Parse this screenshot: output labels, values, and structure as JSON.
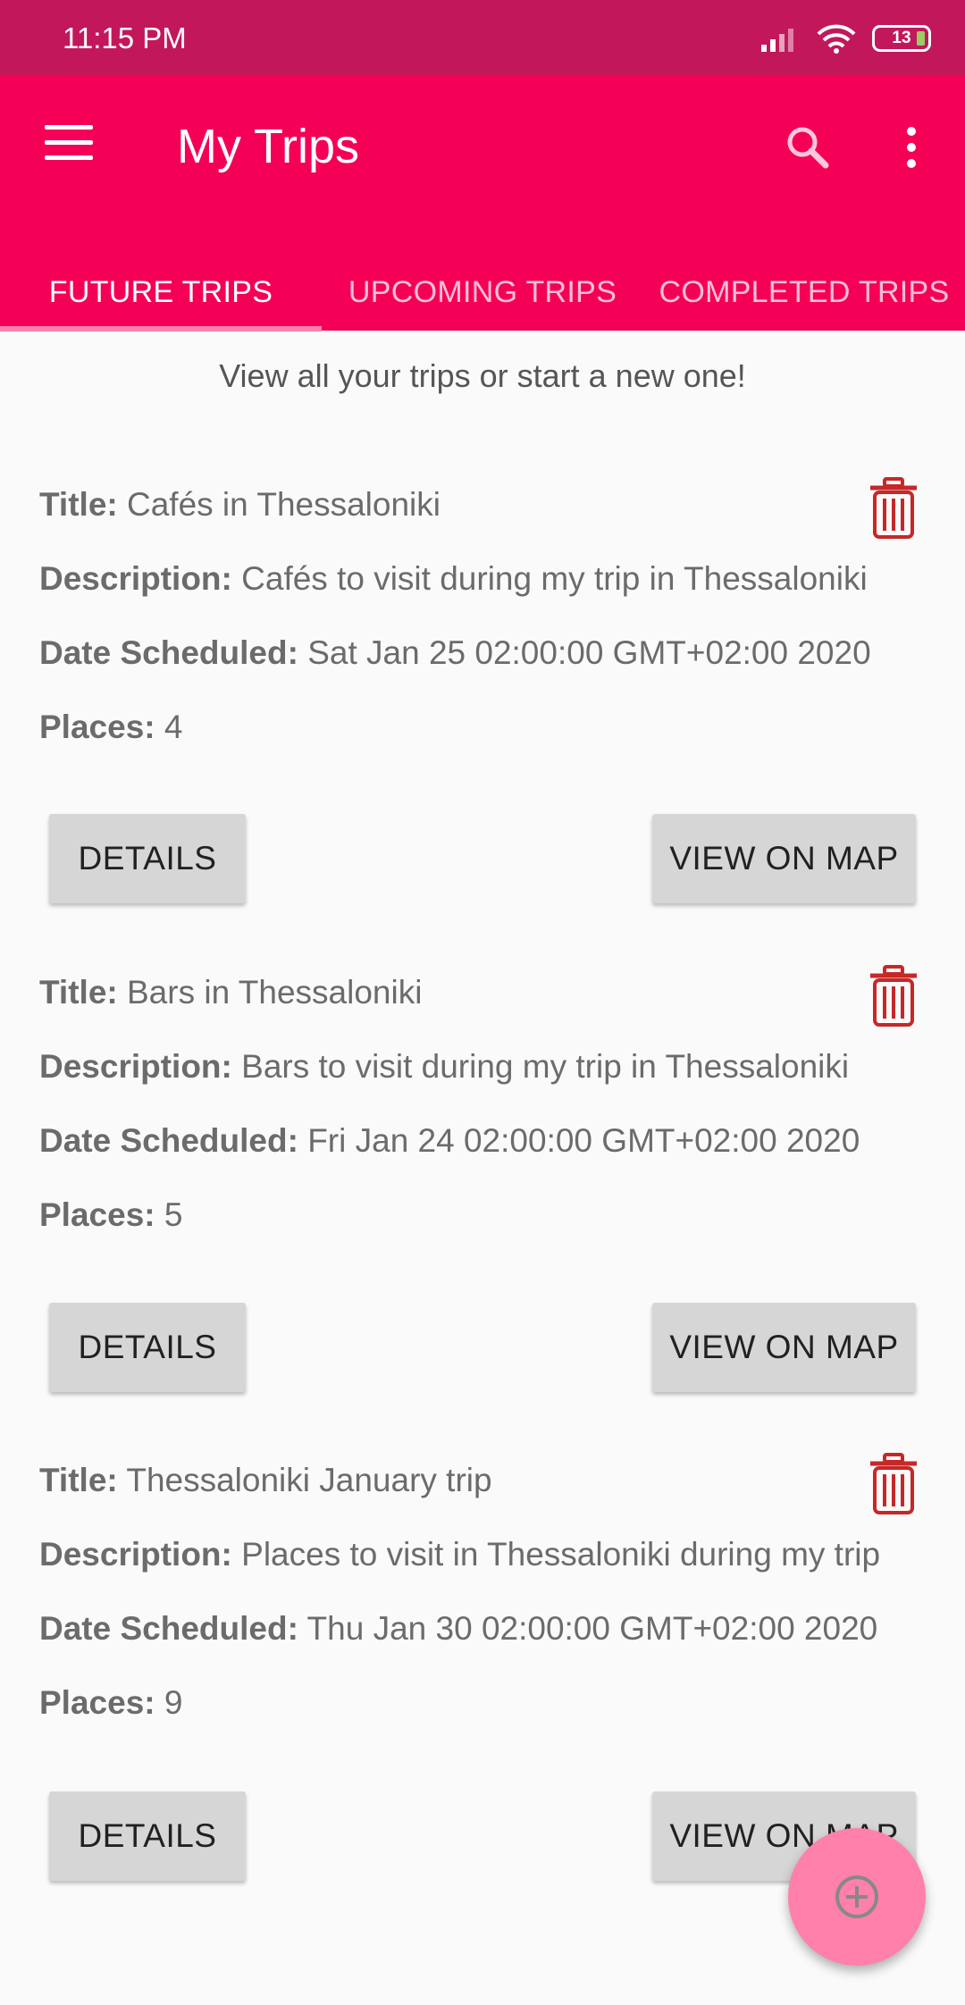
{
  "status_bar": {
    "time": "11:15 PM",
    "battery": "13"
  },
  "app_bar": {
    "title": "My Trips"
  },
  "tabs": [
    {
      "label": "FUTURE TRIPS"
    },
    {
      "label": "UPCOMING TRIPS"
    },
    {
      "label": "COMPLETED TRIPS"
    }
  ],
  "subtitle": "View all your trips or start a new one!",
  "field_labels": {
    "title": "Title:",
    "description": "Description:",
    "date": "Date Scheduled:",
    "places": "Places:"
  },
  "buttons": {
    "details": "DETAILS",
    "view_on_map": "VIEW ON MAP"
  },
  "trips": [
    {
      "title": "Cafés in Thessaloniki",
      "description": "Cafés to visit during my trip in Thessaloniki",
      "date": "Sat Jan 25 02:00:00 GMT+02:00 2020",
      "places": "4"
    },
    {
      "title": "Bars in Thessaloniki",
      "description": "Bars to visit during my trip in Thessaloniki",
      "date": "Fri Jan 24 02:00:00 GMT+02:00 2020",
      "places": "5"
    },
    {
      "title": "Thessaloniki January trip",
      "description": "Places to visit in Thessaloniki during my trip",
      "date": "Thu Jan 30 02:00:00 GMT+02:00 2020",
      "places": "9"
    }
  ],
  "colors": {
    "status_bar": "#c2185b",
    "app_bar": "#f50057",
    "fab": "#ff80ab",
    "delete_icon": "#c62828"
  },
  "icons": [
    "menu-icon",
    "search-icon",
    "more-vert-icon",
    "trash-icon",
    "add-circle-icon"
  ]
}
